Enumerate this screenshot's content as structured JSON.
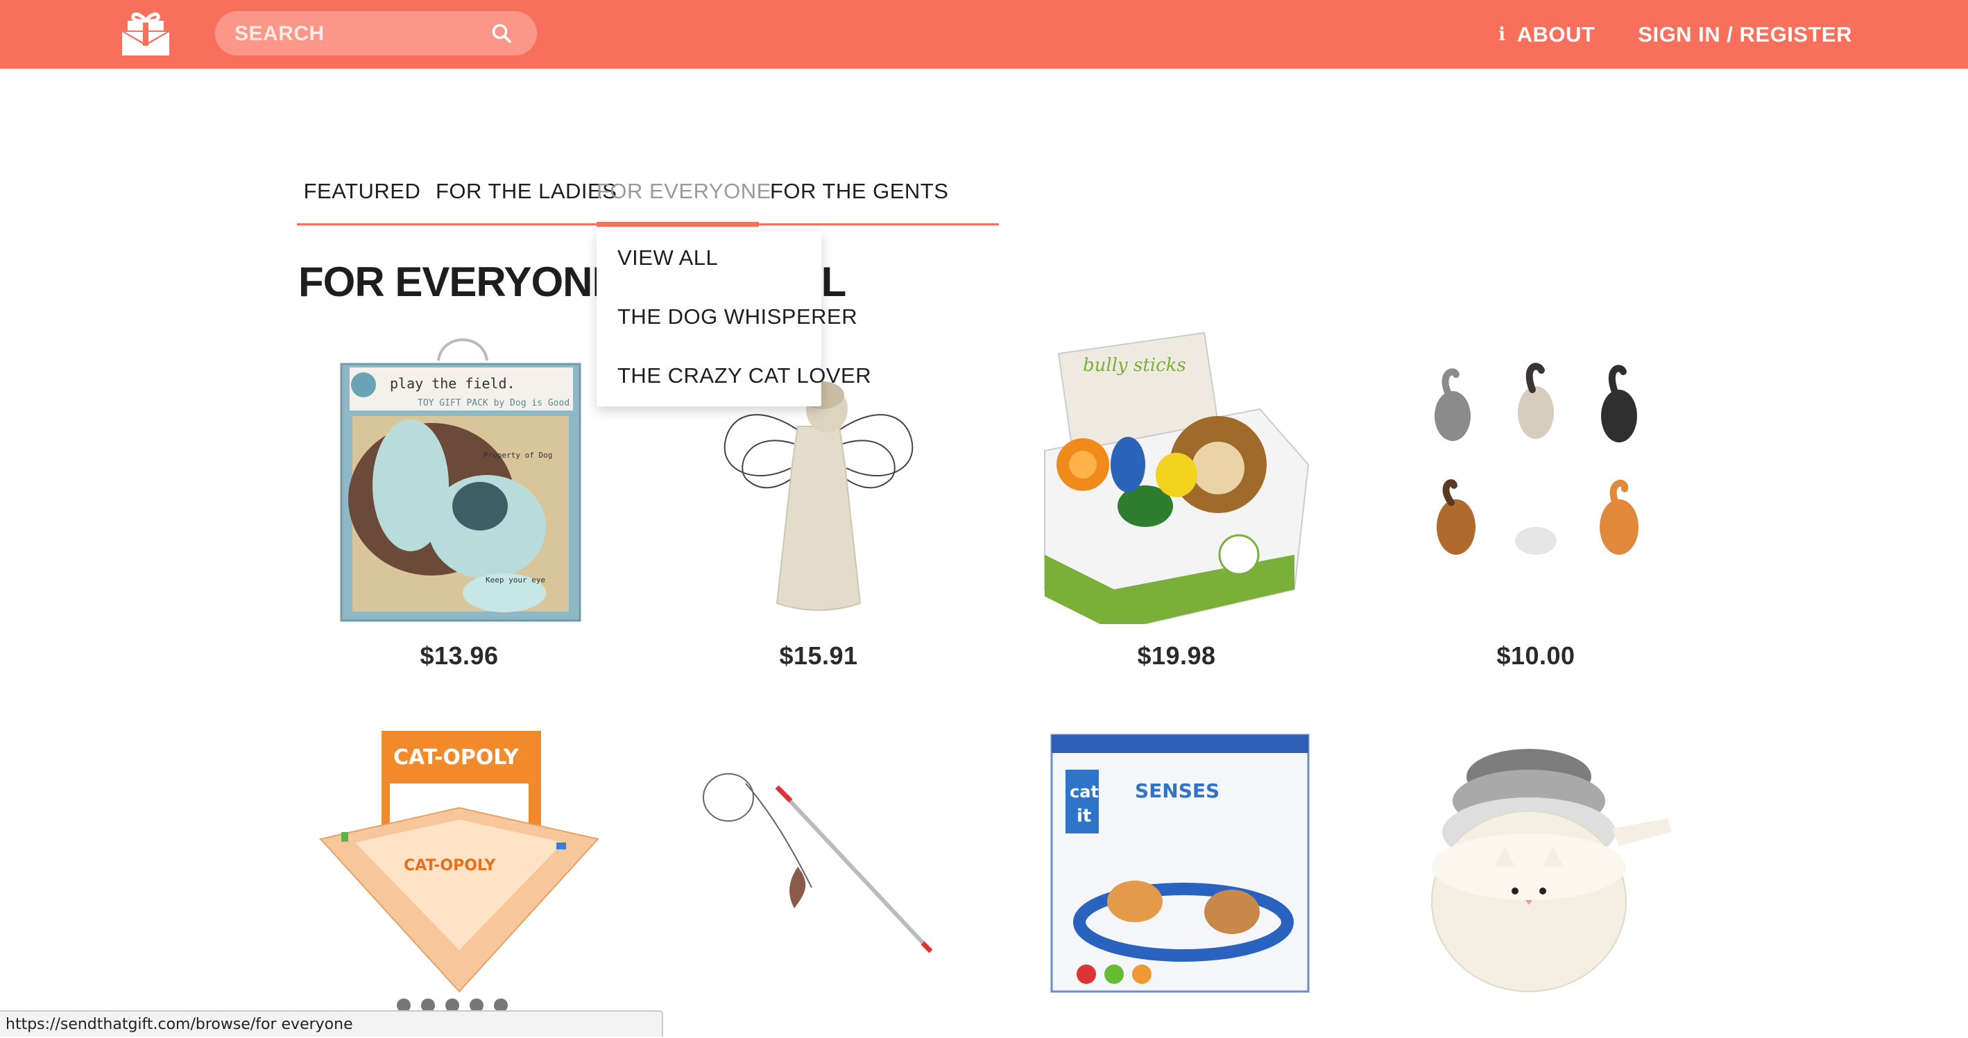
{
  "header": {
    "logo_icon": "gift-envelope-icon",
    "search": {
      "placeholder": "SEARCH",
      "icon": "search-icon"
    },
    "about_label": "ABOUT",
    "about_icon": "info-icon",
    "sign_in_label": "SIGN IN / REGISTER"
  },
  "colors": {
    "brand": "#f8705c",
    "text": "#1e1e1e",
    "muted": "#9a9a9a"
  },
  "tabs": [
    {
      "label": "FEATURED",
      "active": false
    },
    {
      "label": "FOR THE LADIES",
      "active": false
    },
    {
      "label": "FOR EVERYONE",
      "active": true
    },
    {
      "label": "FOR THE GENTS",
      "active": false
    }
  ],
  "dropdown": {
    "items": [
      {
        "label": "VIEW ALL"
      },
      {
        "label": "THE DOG WHISPERER"
      },
      {
        "label": "THE CRAZY CAT LOVER"
      }
    ]
  },
  "page_title": "FOR EVERYONE - VIEW ALL",
  "products": [
    {
      "price": "$13.96",
      "image": "dog-toy-gift-box"
    },
    {
      "price": "$15.91",
      "image": "angel-figurine"
    },
    {
      "price": "$19.98",
      "image": "bully-sticks-box"
    },
    {
      "price": "$10.00",
      "image": "cat-butt-magnets"
    },
    {
      "price": "",
      "image": "cat-opoly-board-game"
    },
    {
      "price": "",
      "image": "cat-wand-toy"
    },
    {
      "price": "",
      "image": "catit-senses-toy"
    },
    {
      "price": "",
      "image": "cat-measuring-cups"
    }
  ],
  "status_bar": {
    "url": "https://sendthatgift.com/browse/for everyone"
  }
}
